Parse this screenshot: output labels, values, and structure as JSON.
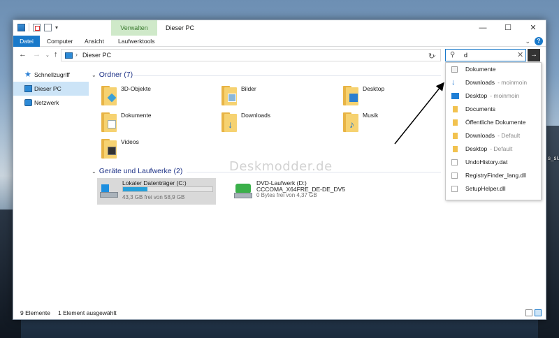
{
  "window": {
    "title": "Dieser PC",
    "context_tab": "Verwalten",
    "controls": {
      "minimize": "—",
      "maximize": "☐",
      "close": "✕"
    }
  },
  "ribbon": {
    "tabs": [
      "Datei",
      "Computer",
      "Ansicht",
      "Laufwerktools"
    ],
    "expand_glyph": "⌄",
    "help_glyph": "?"
  },
  "nav": {
    "back": "←",
    "forward": "→",
    "recent": "⌄",
    "up": "↑",
    "address_sep": "›",
    "address_text": "Dieser PC",
    "address_drop": "⌄",
    "refresh": "↻"
  },
  "search": {
    "value": "d",
    "icon": "⚲",
    "clear": "✕",
    "go": "→"
  },
  "sidebar": {
    "items": [
      {
        "label": "Schnellzugriff",
        "icon": "star-icon",
        "glyph": "★"
      },
      {
        "label": "Dieser PC",
        "icon": "pc-icon",
        "selected": true
      },
      {
        "label": "Netzwerk",
        "icon": "network-icon"
      }
    ]
  },
  "folders_group": {
    "caret": "⌄",
    "title": "Ordner (7)",
    "items": [
      {
        "label": "3D-Objekte",
        "icon": "3d-objects-folder-icon"
      },
      {
        "label": "Bilder",
        "icon": "pictures-folder-icon"
      },
      {
        "label": "Desktop",
        "icon": "desktop-folder-icon"
      },
      {
        "label": "Dokumente",
        "icon": "documents-folder-icon"
      },
      {
        "label": "Downloads",
        "icon": "downloads-folder-icon",
        "glyph": "↓"
      },
      {
        "label": "Musik",
        "icon": "music-folder-icon",
        "glyph": "♪"
      },
      {
        "label": "Videos",
        "icon": "videos-folder-icon"
      }
    ]
  },
  "drives_group": {
    "caret": "⌄",
    "title": "Geräte und Laufwerke (2)",
    "drives": [
      {
        "name": "Lokaler Datenträger (C:)",
        "free": "43,3 GB frei von 58,9 GB",
        "used_fraction": 0.27,
        "selected": true
      },
      {
        "name": "DVD-Laufwerk (D:)",
        "subtitle": "CCCOMA_X64FRE_DE-DE_DV5",
        "free": "0 Bytes frei von 4,37 GB"
      }
    ]
  },
  "suggestions": [
    {
      "label": "Dokumente",
      "sub": "",
      "icon": "documents-icon"
    },
    {
      "label": "Downloads",
      "sub": "- moinmoin",
      "icon": "download-icon",
      "glyph": "↓"
    },
    {
      "label": "Desktop",
      "sub": "- moinmoin",
      "icon": "desktop-icon"
    },
    {
      "label": "Documents",
      "sub": "",
      "icon": "folder-icon"
    },
    {
      "label": "Öffentliche Dokumente",
      "sub": "",
      "icon": "folder-icon"
    },
    {
      "label": "Downloads",
      "sub": "- Default",
      "icon": "folder-icon"
    },
    {
      "label": "Desktop",
      "sub": "- Default",
      "icon": "folder-icon"
    },
    {
      "label": "UndoHistory.dat",
      "sub": "",
      "icon": "file-icon"
    },
    {
      "label": "RegistryFinder_lang.dll",
      "sub": "",
      "icon": "dll-file-icon"
    },
    {
      "label": "SetupHelper.dll",
      "sub": "",
      "icon": "dll-file-icon"
    }
  ],
  "watermark": "Deskmodder.de",
  "desktop_icon_label": "s_si..",
  "status": {
    "count": "9 Elemente",
    "selection": "1 Element ausgewählt"
  },
  "colors": {
    "accent": "#1979ca",
    "context_tab": "#cfe9c9",
    "selection": "#cce4f7"
  }
}
